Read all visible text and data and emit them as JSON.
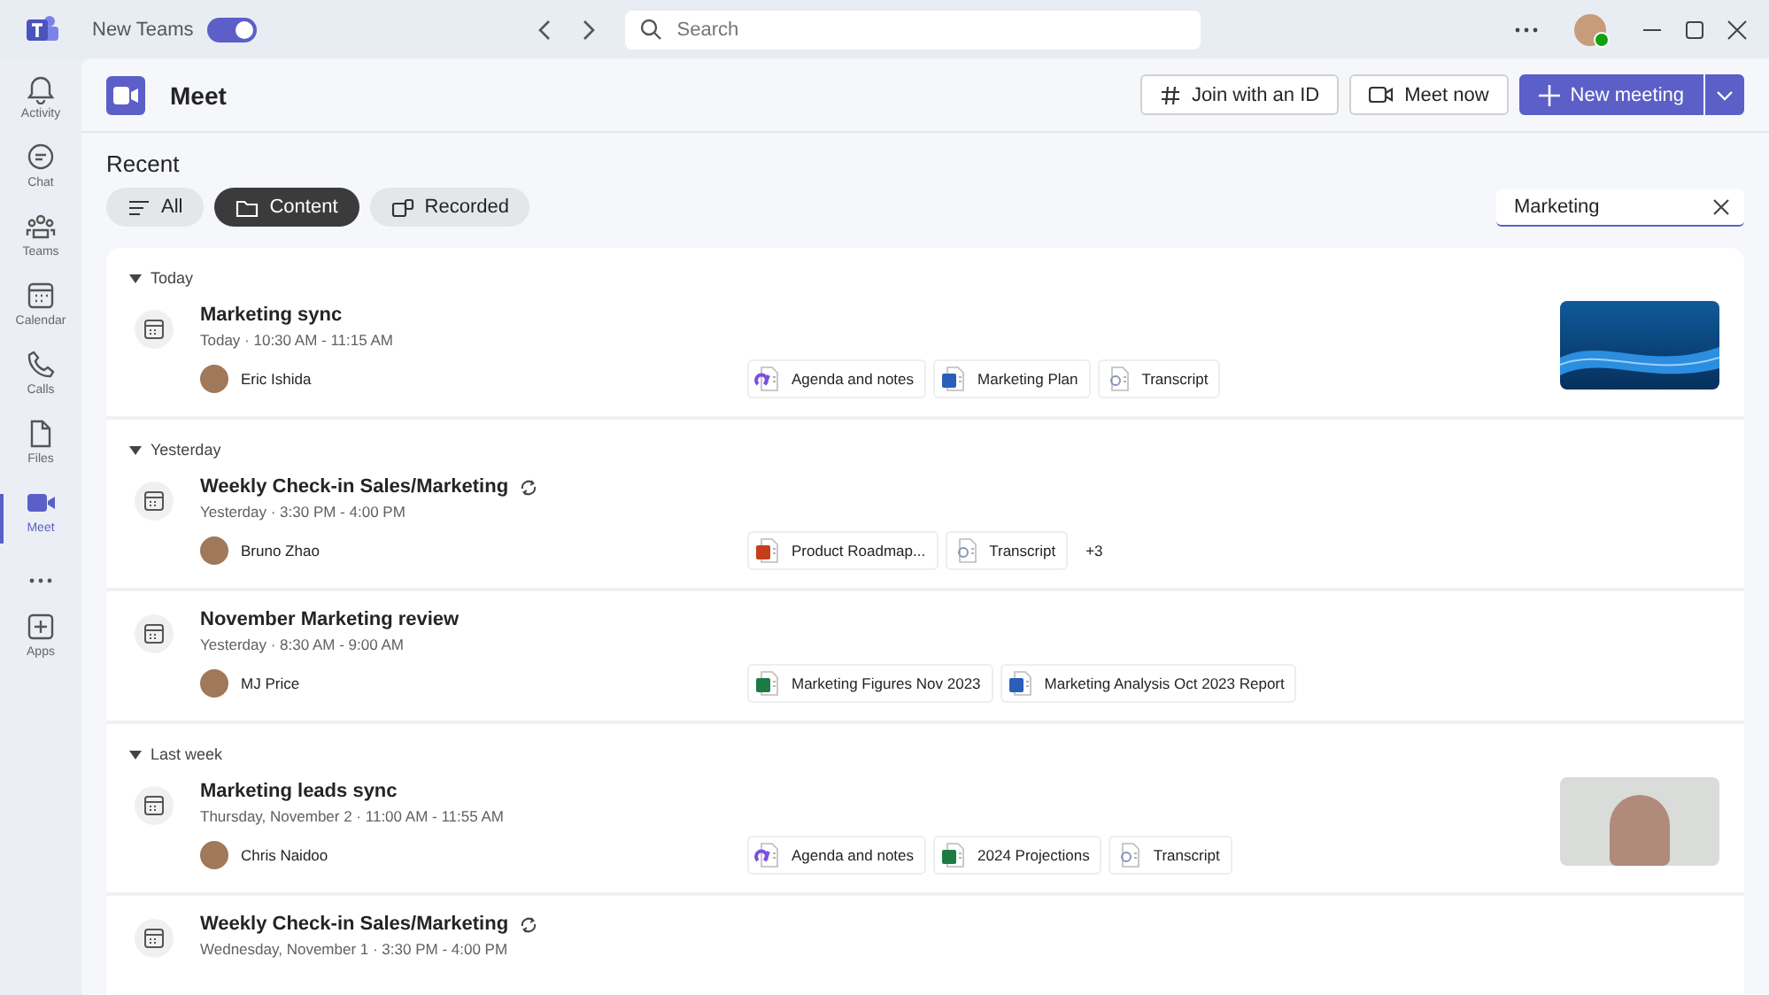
{
  "titlebar": {
    "app_label": "New Teams",
    "new_teams_toggle": {
      "on": true
    },
    "search": {
      "placeholder": "Search"
    }
  },
  "sidebar": {
    "items": [
      {
        "kind": "bell",
        "label": "Activity",
        "selected": false
      },
      {
        "kind": "chat",
        "label": "Chat",
        "selected": false
      },
      {
        "kind": "teams",
        "label": "Teams",
        "selected": false
      },
      {
        "kind": "calendar",
        "label": "Calendar",
        "selected": false
      },
      {
        "kind": "phone",
        "label": "Calls",
        "selected": false
      },
      {
        "kind": "file",
        "label": "Files",
        "selected": false
      },
      {
        "kind": "video",
        "label": "Meet",
        "selected": true
      },
      {
        "kind": "more"
      },
      {
        "kind": "apps",
        "label": "Apps",
        "selected": false
      }
    ]
  },
  "header": {
    "title": "Meet",
    "buttons": [
      {
        "kind": "hash",
        "label": "Join with an ID"
      },
      {
        "kind": "camera",
        "label": "Meet now"
      },
      {
        "kind": "primary",
        "label": "New meeting"
      }
    ]
  },
  "recent": {
    "title": "Recent",
    "filters": [
      {
        "kind": "list",
        "label": "All",
        "selected": false
      },
      {
        "kind": "folder",
        "label": "Content",
        "selected": true
      },
      {
        "kind": "recorded",
        "label": "Recorded",
        "selected": false
      }
    ],
    "filter_field": {
      "value": "Marketing"
    }
  },
  "groups": [
    {
      "label": "Today",
      "expanded": true,
      "meetings": [
        {
          "title": "Marketing sync",
          "recurring": false,
          "time": "Today · 10:30 AM - 11:15 AM",
          "person": "Eric Ishida",
          "files": [
            {
              "kind": "loop",
              "name": "Agenda and notes"
            },
            {
              "kind": "word",
              "name": "Marketing Plan"
            },
            {
              "kind": "transcript",
              "name": "Transcript"
            }
          ],
          "preview": {
            "kind": "slide"
          }
        }
      ]
    },
    {
      "label": "Yesterday",
      "expanded": true,
      "meetings": [
        {
          "title": "Weekly Check-in Sales/Marketing",
          "recurring": true,
          "time": "Yesterday · 3:30 PM - 4:00 PM",
          "person": "Bruno Zhao",
          "files": [
            {
              "kind": "powerpoint",
              "name": "Product Roadmap..."
            },
            {
              "kind": "transcript",
              "name": "Transcript"
            }
          ],
          "more": "+3"
        },
        {
          "title": "November Marketing review",
          "recurring": false,
          "time": "Yesterday · 8:30 AM - 9:00 AM",
          "person": "MJ Price",
          "files": [
            {
              "kind": "excel",
              "name": "Marketing Figures Nov 2023"
            },
            {
              "kind": "word",
              "name": "Marketing Analysis Oct 2023 Report"
            }
          ]
        }
      ]
    },
    {
      "label": "Last week",
      "expanded": true,
      "meetings": [
        {
          "title": "Marketing leads sync",
          "recurring": false,
          "time": "Thursday, November 2 · 11:00 AM - 11:55 AM",
          "person": "Chris Naidoo",
          "files": [
            {
              "kind": "loop",
              "name": "Agenda and notes"
            },
            {
              "kind": "excel",
              "name": "2024 Projections"
            },
            {
              "kind": "transcript",
              "name": "Transcript"
            }
          ],
          "preview": {
            "kind": "video"
          }
        },
        {
          "title": "Weekly Check-in Sales/Marketing",
          "recurring": true,
          "time": "Wednesday, November 1 · 3:30 PM - 4:00 PM"
        }
      ]
    }
  ]
}
